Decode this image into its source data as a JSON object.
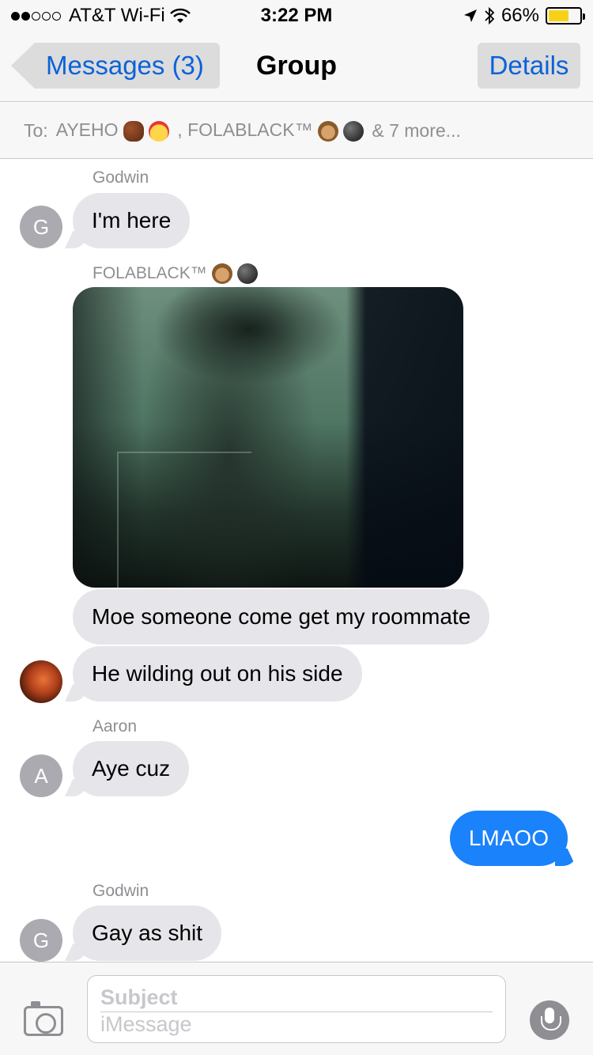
{
  "status_bar": {
    "carrier": "AT&T Wi-Fi",
    "signal_bars_filled": 2,
    "signal_bars_total": 5,
    "time": "3:22 PM",
    "battery_percent": "66%",
    "battery_level": 0.66,
    "battery_color": "#f7d117"
  },
  "nav": {
    "back_label": "Messages (3)",
    "title": "Group",
    "details_label": "Details",
    "accent_color": "#0b62d8"
  },
  "recipients": {
    "prefix": "To:",
    "name1": "AYEHO",
    "name2": ", FOLABLACK™",
    "more": "& 7 more..."
  },
  "messages": [
    {
      "sender": "Godwin",
      "avatar_initial": "G",
      "text": "I'm here"
    },
    {
      "sender": "FOLABLACK™",
      "type": "photo"
    },
    {
      "text": "Moe someone come get my roommate"
    },
    {
      "text": "He wilding out on his side"
    },
    {
      "sender": "Aaron",
      "avatar_initial": "A",
      "text": "Aye cuz"
    },
    {
      "direction": "sent",
      "text": "LMAOO"
    },
    {
      "sender": "Godwin",
      "avatar_initial": "G",
      "text": "Gay as shit"
    }
  ],
  "composer": {
    "subject_placeholder": "Subject",
    "message_placeholder": "iMessage"
  },
  "colors": {
    "received_bubble": "#e5e5ea",
    "sent_bubble": "#1a82fb"
  },
  "icons": [
    "wifi-icon",
    "location-arrow-icon",
    "bluetooth-icon",
    "battery-icon",
    "back-chevron-icon",
    "camera-icon",
    "microphone-icon"
  ]
}
